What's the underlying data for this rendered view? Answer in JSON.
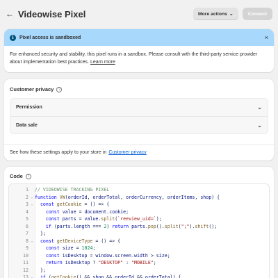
{
  "header": {
    "title": "Videowise Pixel",
    "more_actions": "More actions",
    "connect": "Connect"
  },
  "banner": {
    "title": "Pixel access is sandboxed",
    "body": "For enhanced security and stability, this pixel runs in a sandbox. Please consult with the third-party service provider about implementation best practices.",
    "link": "Learn more"
  },
  "privacy": {
    "title": "Customer privacy",
    "items": [
      {
        "label": "Permission"
      },
      {
        "label": "Data sale"
      }
    ],
    "footer_text": "See how these settings apply to your store in",
    "footer_link": "Customer privacy"
  },
  "code": {
    "title": "Code",
    "lines": [
      {
        "n": "1",
        "fold": false,
        "text": "// VIDEOWISE TRACKING PIXEL"
      },
      {
        "n": "2",
        "fold": true,
        "text": "function VW(orderId, orderTotal, orderCurrency, orderItems, shop) {"
      },
      {
        "n": "3",
        "fold": true,
        "text": "  const getCookie = () => {"
      },
      {
        "n": "4",
        "fold": false,
        "text": "    const value = document.cookie;"
      },
      {
        "n": "5",
        "fold": false,
        "text": "    const parts = value.split(`reeview_uid=`);"
      },
      {
        "n": "6",
        "fold": false,
        "text": "    if (parts.length === 2) return parts.pop().split(\";\").shift();"
      },
      {
        "n": "7",
        "fold": false,
        "text": "  };"
      },
      {
        "n": "8",
        "fold": true,
        "text": "  const getDeviceType = () => {"
      },
      {
        "n": "9",
        "fold": false,
        "text": "    const size = 1024;"
      },
      {
        "n": "10",
        "fold": false,
        "text": "    const isDesktop = window.screen.width > size;"
      },
      {
        "n": "11",
        "fold": false,
        "text": "    return isDesktop ? \"DESKTOP\" : \"MOBILE\";"
      },
      {
        "n": "12",
        "fold": false,
        "text": "  };"
      },
      {
        "n": "13",
        "fold": true,
        "text": "  if (getCookie() && shop && orderId && orderTotal) {"
      }
    ]
  },
  "icons": {
    "back": "arrow-left-icon",
    "info": "info-icon",
    "close": "close-icon",
    "chevron": "chevron-down-icon",
    "help": "question-circle-icon",
    "fold": "fold-chevron-icon"
  },
  "colors": {
    "banner_bg": "#a8d8fb",
    "link": "#005bd3",
    "page_bg": "#f1f1f1"
  }
}
